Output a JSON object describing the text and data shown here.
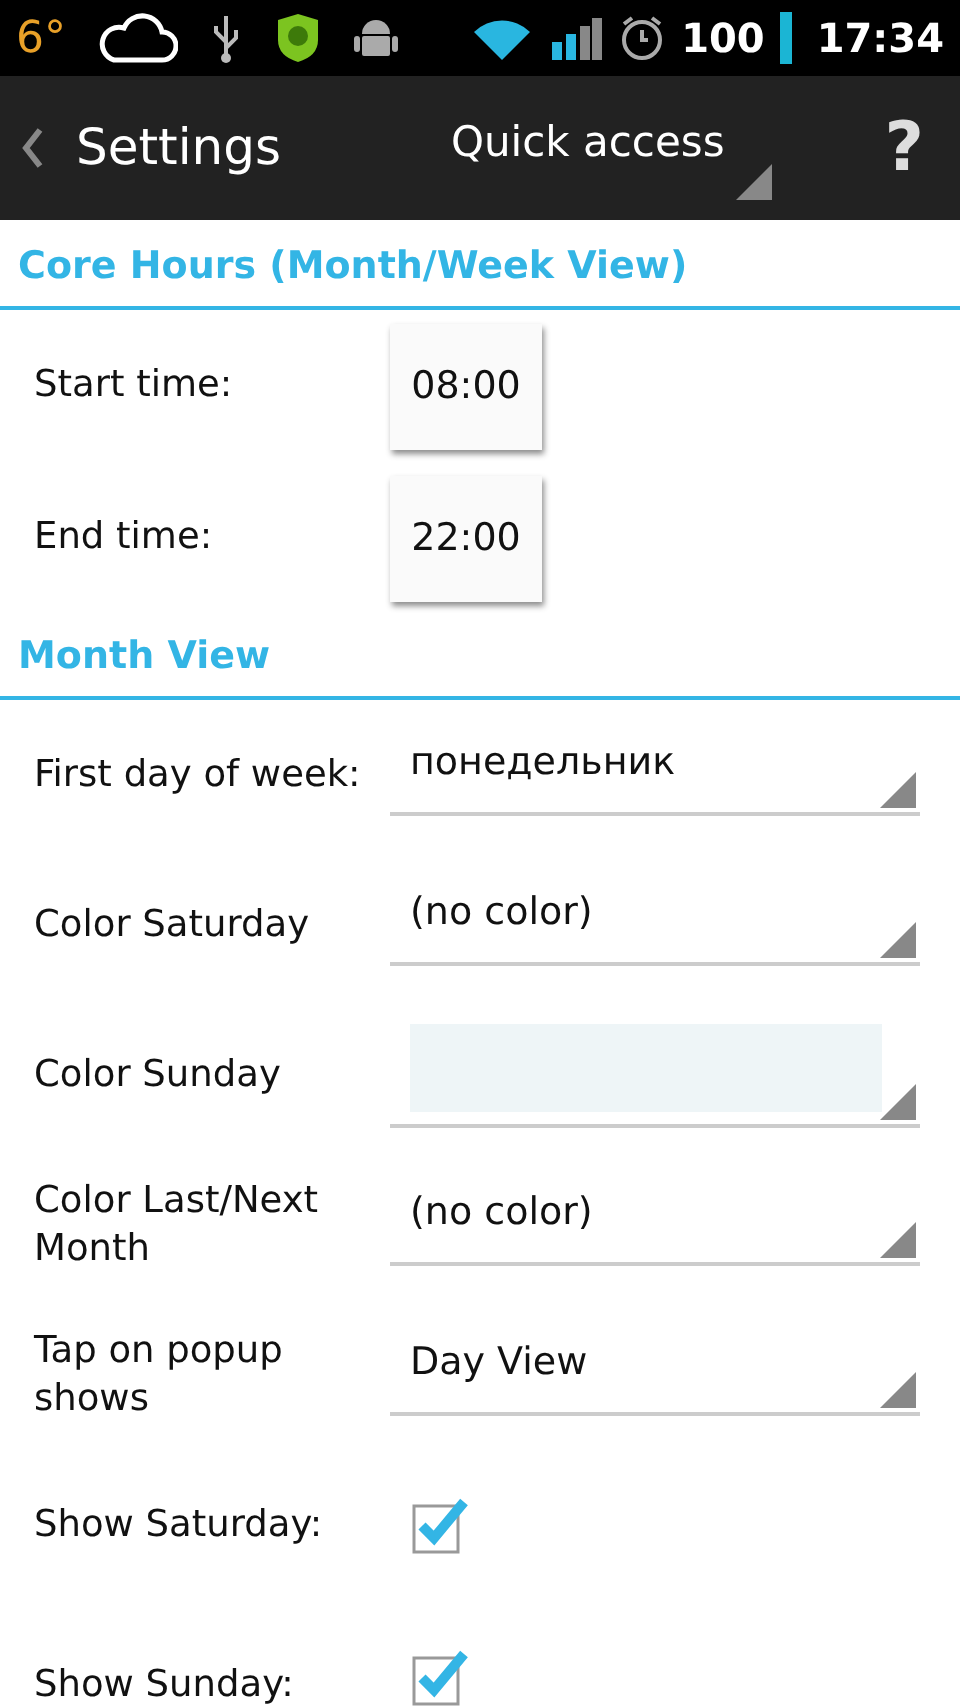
{
  "status_bar": {
    "temperature": "6°",
    "battery": "100",
    "time": "17:34"
  },
  "action_bar": {
    "title": "Settings",
    "dropdown": "Quick access",
    "help": "?"
  },
  "sections": [
    {
      "title": "Core Hours (Month/Week View)",
      "rows": [
        {
          "kind": "time",
          "label": "Start time:",
          "value": "08:00"
        },
        {
          "kind": "time",
          "label": "End time:",
          "value": "22:00"
        }
      ]
    },
    {
      "title": "Month View",
      "rows": [
        {
          "kind": "select",
          "label": "First day of week:",
          "value": "понедельник"
        },
        {
          "kind": "select",
          "label": "Color Saturday",
          "value": "(no color)"
        },
        {
          "kind": "color",
          "label": "Color Sunday",
          "color": "#eef5f7"
        },
        {
          "kind": "select",
          "label": "Color Last/Next Month",
          "value": "(no color)"
        },
        {
          "kind": "select",
          "label": "Tap on popup shows",
          "value": "Day View"
        },
        {
          "kind": "checkbox",
          "label": "Show Saturday:",
          "checked": true
        },
        {
          "kind": "checkbox",
          "label": "Show Sunday:",
          "checked": true
        }
      ]
    }
  ]
}
